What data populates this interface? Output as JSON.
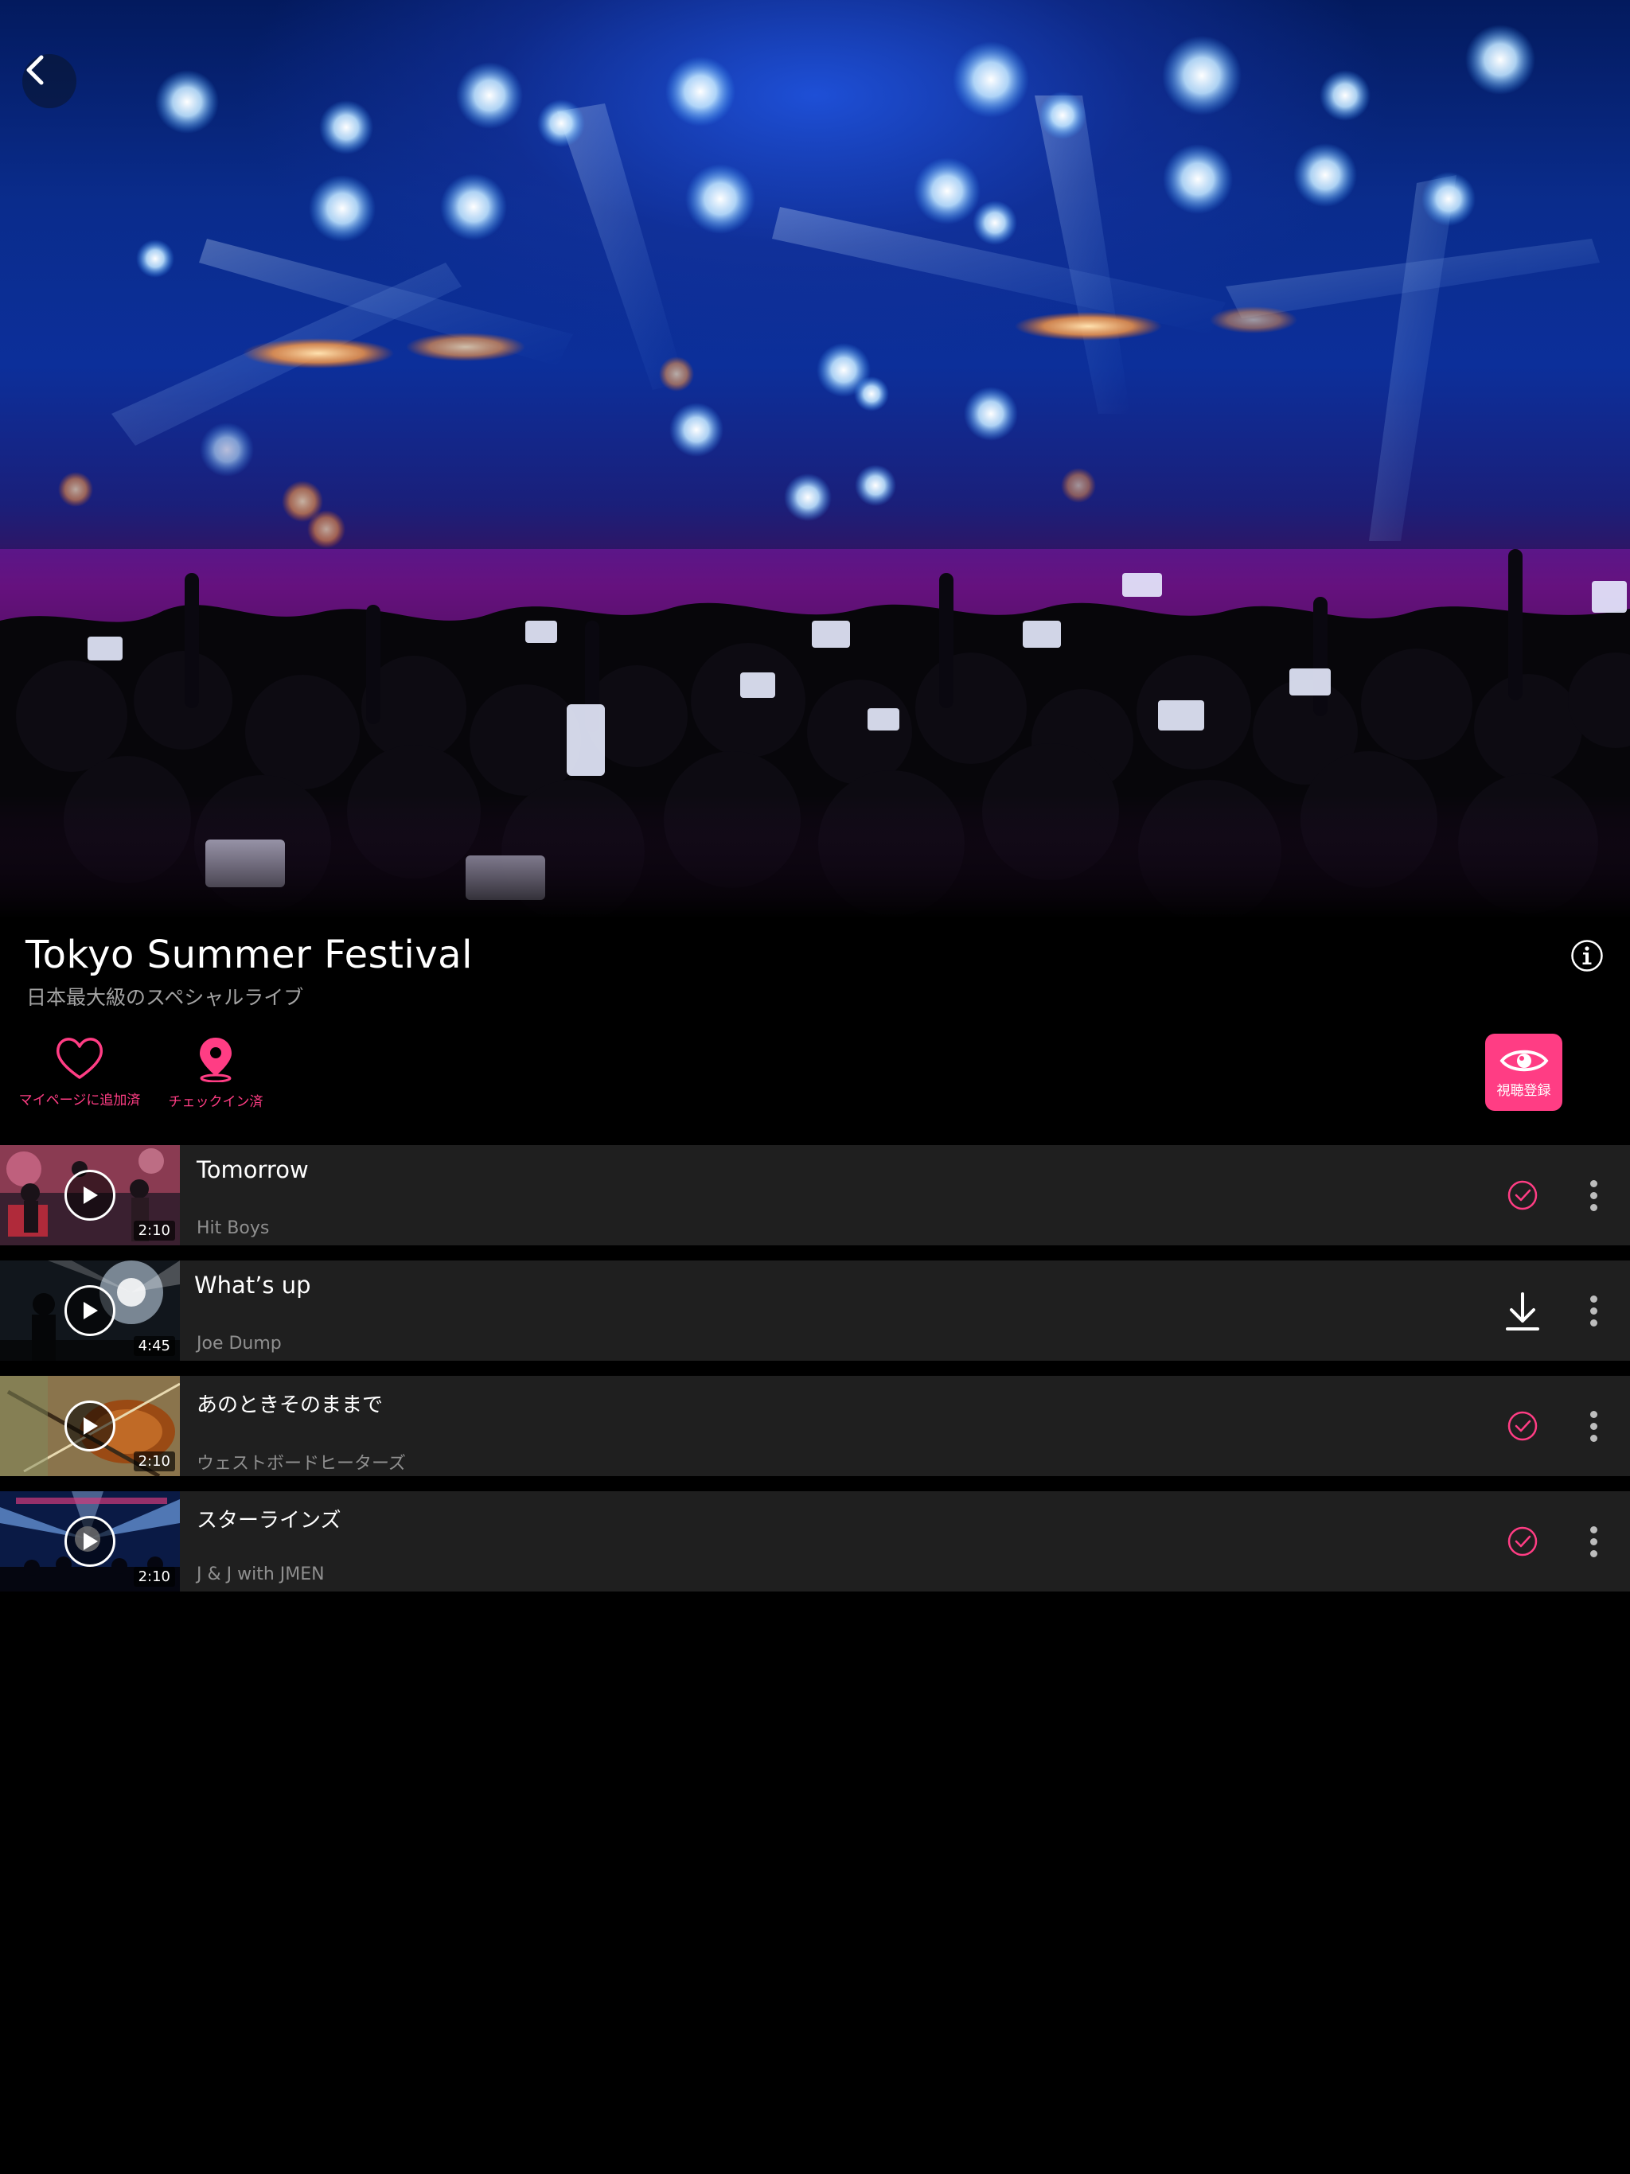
{
  "event": {
    "title": "Tokyo Summer Festival",
    "subtitle": "日本最大級のスペシャルライブ"
  },
  "icons": {
    "back": "chevron-left-icon",
    "info": "info-circle-icon",
    "favorite": "heart-outline-icon",
    "checkin": "map-pin-icon",
    "register": "eye-icon",
    "status_done": "check-circle-icon",
    "download": "download-icon",
    "more": "more-vertical-icon",
    "play": "play-icon"
  },
  "actions": {
    "favorite_label": "マイページに追加済",
    "checkin_label": "チェックイン済",
    "register_label": "視聴登録"
  },
  "colors": {
    "accent": "#ff3d84",
    "background": "#000000",
    "row": "#1f1f1f",
    "secondary_text": "#8f8f8f"
  },
  "tracks": [
    {
      "title": "Tomorrow",
      "artist": "Hit Boys",
      "duration": "2:10",
      "status": "downloaded"
    },
    {
      "title": "What’s up",
      "artist": "Joe Dump",
      "duration": "4:45",
      "status": "download"
    },
    {
      "title": "あのときそのままで",
      "artist": "ウェストボードヒーターズ",
      "duration": "2:10",
      "status": "downloaded"
    },
    {
      "title": "スターラインズ",
      "artist": "J & J with JMEN",
      "duration": "2:10",
      "status": "downloaded"
    }
  ]
}
